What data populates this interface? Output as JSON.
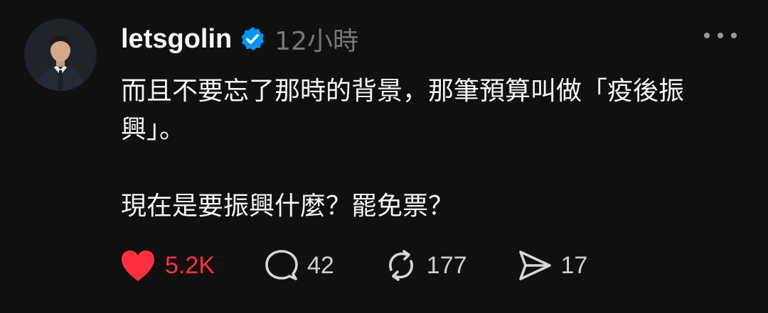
{
  "post": {
    "username": "letsgolin",
    "timestamp": "12小時",
    "verified_color": "#0095f6",
    "text_line_1": "而且不要忘了那時的背景，那筆預算叫做「疫後振興」。",
    "text_line_2": "現在是要振興什麼？罷免票？"
  },
  "actions": {
    "like": {
      "icon": "heart-filled-icon",
      "count": "5.2K",
      "color": "#ff3040"
    },
    "reply": {
      "icon": "comment-bubble-icon",
      "count": "42"
    },
    "repost": {
      "icon": "repost-icon",
      "count": "177"
    },
    "share": {
      "icon": "send-icon",
      "count": "17"
    }
  }
}
